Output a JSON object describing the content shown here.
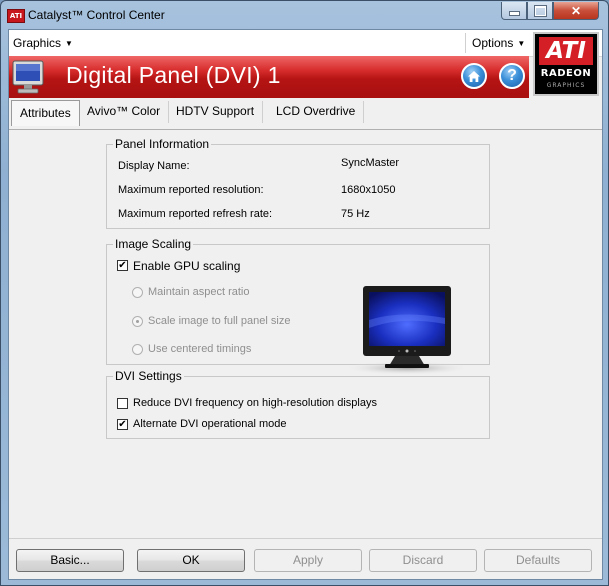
{
  "window": {
    "title": "Catalyst™ Control Center",
    "app_icon_text": "ATI",
    "close_glyph": "✕"
  },
  "menubar": {
    "graphics_label": "Graphics",
    "options_label": "Options",
    "caret": "▼"
  },
  "header": {
    "title": "Digital Panel (DVI) 1",
    "home_icon": "home-icon",
    "help_glyph": "?"
  },
  "logo": {
    "brand": "ATI",
    "product": "RADEON",
    "sub": "GRAPHICS"
  },
  "tabs": [
    {
      "label": "Attributes",
      "active": true
    },
    {
      "label": "Avivo™ Color",
      "active": false
    },
    {
      "label": "HDTV Support",
      "active": false
    },
    {
      "label": "LCD Overdrive",
      "active": false
    }
  ],
  "panel_information": {
    "legend": "Panel Information",
    "rows": [
      {
        "label": "Display Name:",
        "value": "SyncMaster"
      },
      {
        "label": "Maximum reported resolution:",
        "value": "1680x1050"
      },
      {
        "label": "Maximum reported refresh rate:",
        "value": "75 Hz"
      }
    ]
  },
  "image_scaling": {
    "legend": "Image Scaling",
    "enable_gpu_scaling": {
      "label": "Enable GPU scaling",
      "checked": true
    },
    "options": [
      {
        "label": "Maintain aspect ratio",
        "selected": false,
        "enabled": false
      },
      {
        "label": "Scale image to full panel size",
        "selected": true,
        "enabled": false
      },
      {
        "label": "Use centered timings",
        "selected": false,
        "enabled": false
      }
    ]
  },
  "dvi_settings": {
    "legend": "DVI Settings",
    "reduce_dvi": {
      "label": "Reduce DVI frequency on high-resolution displays",
      "checked": false
    },
    "alternate_dvi": {
      "label": "Alternate DVI operational mode",
      "checked": true
    }
  },
  "check_mark": "✔",
  "buttons": {
    "basic": "Basic...",
    "ok": "OK",
    "apply": "Apply",
    "discard": "Discard",
    "defaults": "Defaults"
  },
  "colors": {
    "header_red": "#b51414",
    "title_bar_blue": "#9cbad8",
    "ati_red": "#d41f26"
  }
}
